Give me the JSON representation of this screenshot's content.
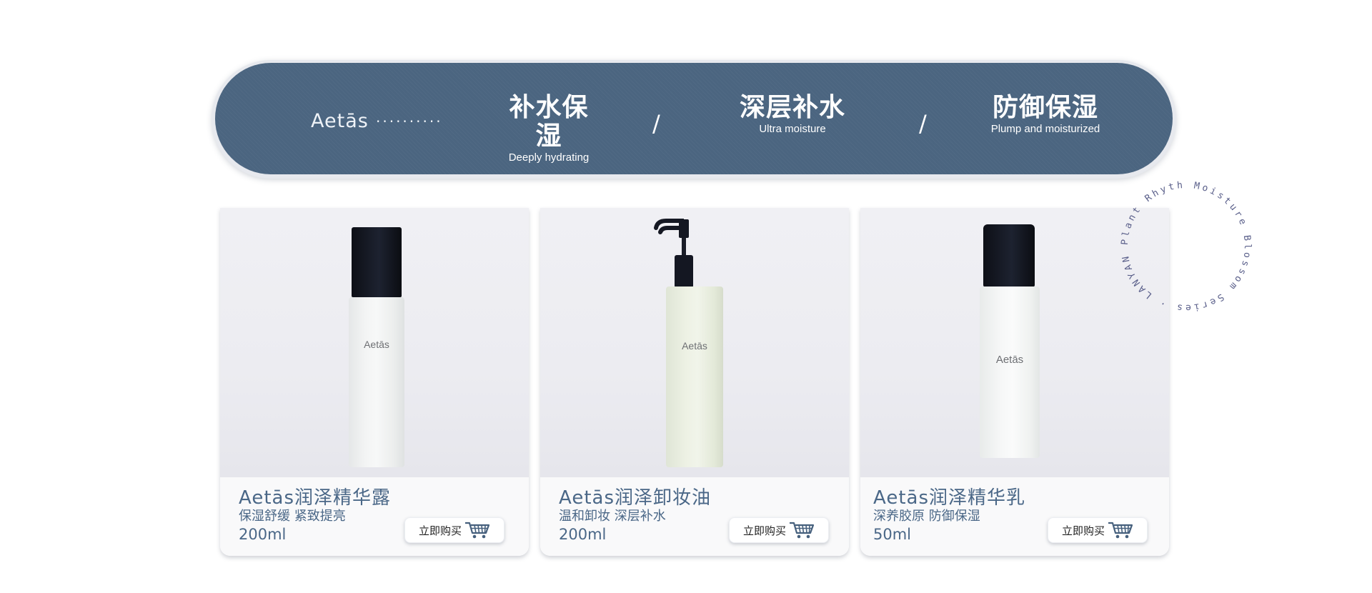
{
  "banner": {
    "brand": "Aetās",
    "dots": "··········",
    "features": [
      {
        "zh": "补水保湿",
        "en": "Deeply hydrating"
      },
      {
        "zh": "深层补水",
        "en": "Ultra moisture"
      },
      {
        "zh": "防御保湿",
        "en": "Plump and moisturized"
      }
    ],
    "separator": "/"
  },
  "products": [
    {
      "name": "Aetās润泽精华露",
      "tagline": "保湿舒缓 紧致提亮",
      "volume": "200ml",
      "bottle_label": "Aetās",
      "buy_label": "立即购买"
    },
    {
      "name": "Aetās润泽卸妆油",
      "tagline": "温和卸妆  深层补水",
      "volume": "200ml",
      "bottle_label": "Aetās",
      "buy_label": "立即购买"
    },
    {
      "name": "Aetās润泽精华乳",
      "tagline": "深养胶原 防御保湿",
      "volume": "50ml",
      "bottle_label": "Aetās",
      "buy_label": "立即购买"
    }
  ],
  "ring_text": "Moisture Blossom Series · LANYAN Plant Rhythm ·",
  "colors": {
    "banner": "#4b6580",
    "text": "#4a6787",
    "ring_text": "#5a5f8a"
  },
  "icons": {
    "buy": "shopping-cart-icon"
  }
}
